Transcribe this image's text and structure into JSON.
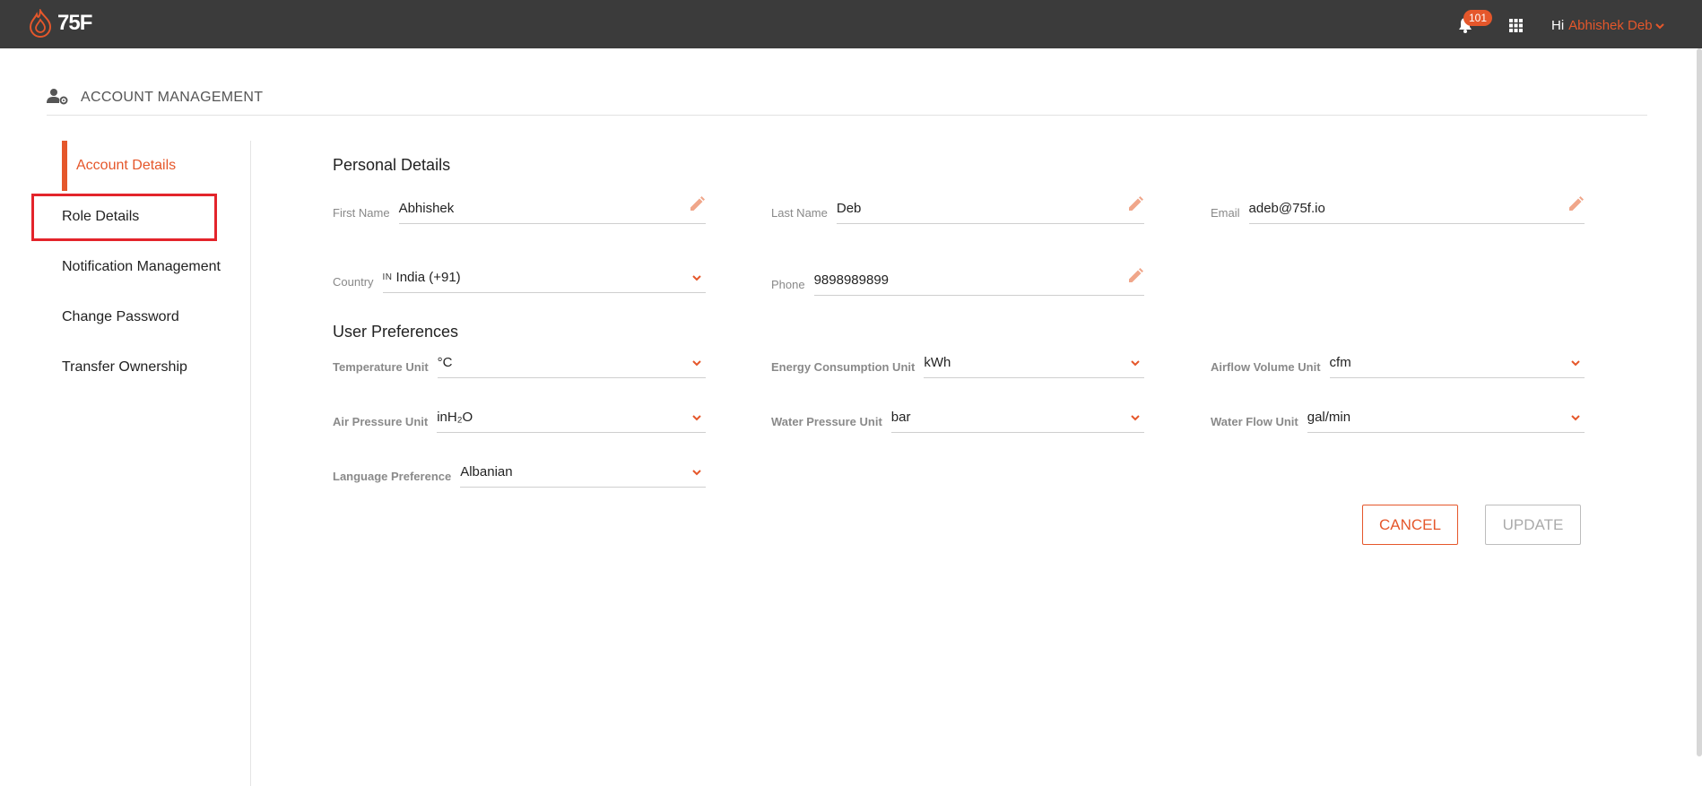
{
  "app": {
    "logo_text": "75F"
  },
  "header": {
    "notification_count": "101",
    "greeting": "Hi",
    "user_name": "Abhishek Deb"
  },
  "page": {
    "title": "ACCOUNT MANAGEMENT"
  },
  "sidebar": {
    "items": [
      {
        "label": "Account Details",
        "active": true
      },
      {
        "label": "Role Details"
      },
      {
        "label": "Notification Management"
      },
      {
        "label": "Change Password"
      },
      {
        "label": "Transfer Ownership"
      }
    ]
  },
  "personal": {
    "title": "Personal Details",
    "first_name": {
      "label": "First Name",
      "value": "Abhishek"
    },
    "last_name": {
      "label": "Last Name",
      "value": "Deb"
    },
    "email": {
      "label": "Email",
      "value": "adeb@75f.io"
    },
    "country": {
      "label": "Country",
      "flag": "IN",
      "value": "India (+91)"
    },
    "phone": {
      "label": "Phone",
      "value": "9898989899"
    }
  },
  "preferences": {
    "title": "User Preferences",
    "temperature": {
      "label": "Temperature Unit",
      "value": "°C"
    },
    "energy": {
      "label": "Energy Consumption Unit",
      "value": "kWh"
    },
    "airflow": {
      "label": "Airflow Volume Unit",
      "value": "cfm"
    },
    "air_pressure": {
      "label": "Air Pressure Unit",
      "value": "inH₂O"
    },
    "water_pressure": {
      "label": "Water Pressure Unit",
      "value": "bar"
    },
    "water_flow": {
      "label": "Water Flow Unit",
      "value": "gal/min"
    },
    "language": {
      "label": "Language Preference",
      "value": "Albanian"
    }
  },
  "actions": {
    "cancel": "CANCEL",
    "update": "UPDATE"
  },
  "colors": {
    "accent": "#e5572b",
    "topbar": "#3b3b3b",
    "highlight": "#e3242b"
  }
}
